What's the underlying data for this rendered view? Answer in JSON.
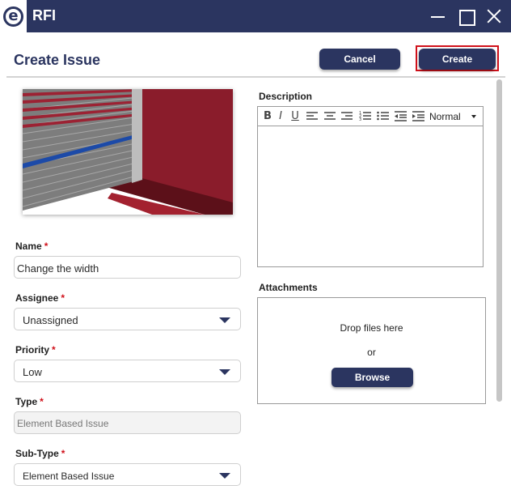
{
  "window": {
    "title": "RFI",
    "logo_glyph": "e",
    "icons": [
      "minimize-icon",
      "maximize-icon",
      "close-icon"
    ]
  },
  "header": {
    "title": "Create Issue",
    "cancel_label": "Cancel",
    "create_label": "Create"
  },
  "form": {
    "required_marker": "*",
    "name": {
      "label": "Name",
      "value": "Change the width"
    },
    "assignee": {
      "label": "Assignee",
      "value": "Unassigned"
    },
    "priority": {
      "label": "Priority",
      "value": "Low"
    },
    "type": {
      "label": "Type",
      "value": "Element Based Issue"
    },
    "subtype": {
      "label": "Sub-Type",
      "value": "Element Based Issue"
    }
  },
  "description": {
    "label": "Description",
    "toolbar": {
      "bold": "B",
      "italic": "I",
      "underline": "U",
      "format_value": "Normal"
    }
  },
  "attachments": {
    "label": "Attachments",
    "drop_text": "Drop files here",
    "or_text": "or",
    "browse_label": "Browse"
  },
  "colors": {
    "brand_navy": "#2b3560",
    "highlight_red": "#d0101a",
    "thumbnail_wall": "#8a1c2b",
    "thumbnail_stripe": "#1c4aa8"
  }
}
